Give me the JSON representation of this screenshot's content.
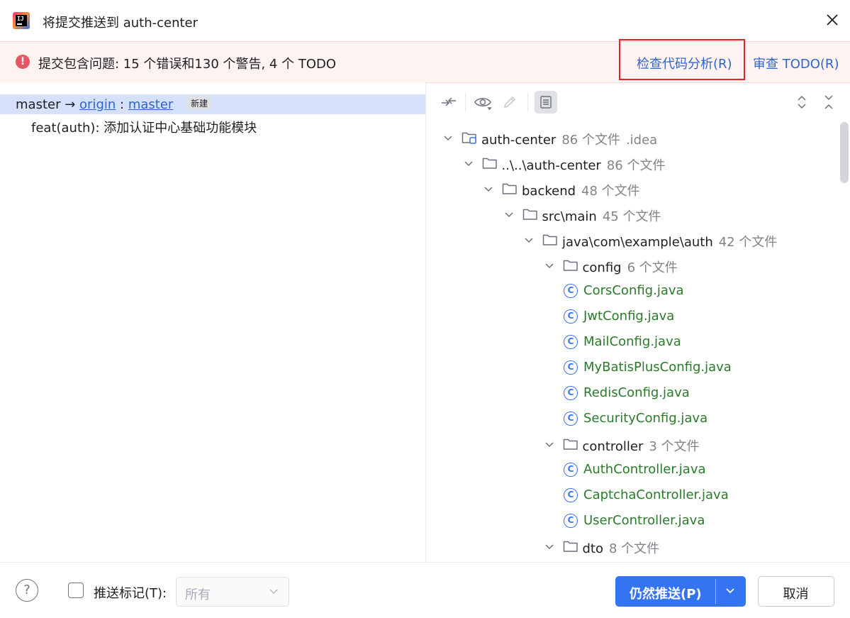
{
  "window": {
    "title": "将提交推送到 auth-center"
  },
  "banner": {
    "message": "提交包含问题: 15 个错误和130 个警告, 4 个 TODO",
    "analyze_link": "检查代码分析(R)",
    "todo_link": "审查 TODO(R)"
  },
  "commits": {
    "local_branch": "master",
    "arrow": "→",
    "remote": "origin",
    "sep": ":",
    "remote_branch": "master",
    "badge": "新建",
    "message": "feat(auth): 添加认证中心基础功能模块"
  },
  "tree": [
    {
      "name": "auth-center",
      "count": "86 个文件",
      "extra": ".idea"
    },
    {
      "name": "..\\..\\auth-center",
      "count": "86 个文件"
    },
    {
      "name": "backend",
      "count": "48 个文件"
    },
    {
      "name": "src\\main",
      "count": "45 个文件"
    },
    {
      "name": "java\\com\\example\\auth",
      "count": "42 个文件"
    },
    {
      "name": "config",
      "count": "6 个文件"
    },
    {
      "name": "CorsConfig.java"
    },
    {
      "name": "JwtConfig.java"
    },
    {
      "name": "MailConfig.java"
    },
    {
      "name": "MyBatisPlusConfig.java"
    },
    {
      "name": "RedisConfig.java"
    },
    {
      "name": "SecurityConfig.java"
    },
    {
      "name": "controller",
      "count": "3 个文件"
    },
    {
      "name": "AuthController.java"
    },
    {
      "name": "CaptchaController.java"
    },
    {
      "name": "UserController.java"
    },
    {
      "name": "dto",
      "count": "8 个文件"
    }
  ],
  "footer": {
    "help": "?",
    "push_tags_label": "推送标记(T):",
    "tags_value": "所有",
    "push_button": "仍然推送(P)",
    "cancel_button": "取消"
  },
  "colors": {
    "accent": "#3574f0",
    "error": "#e55765",
    "link": "#2f65ca",
    "added_file": "#2a7a2a",
    "highlight_box": "#e0262a"
  }
}
